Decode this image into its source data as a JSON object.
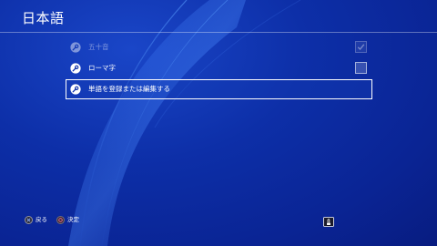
{
  "header": {
    "title": "日本語"
  },
  "menu": {
    "items": [
      {
        "label": "五十音",
        "icon": "wrench-icon",
        "checked": true,
        "enabled": false,
        "selected": false
      },
      {
        "label": "ローマ字",
        "icon": "wrench-icon",
        "checked": false,
        "enabled": true,
        "selected": false
      },
      {
        "label": "単語を登録または編集する",
        "icon": "wrench-icon",
        "selected": true
      }
    ]
  },
  "footer": {
    "back_label": "戻る",
    "confirm_label": "決定"
  },
  "colors": {
    "background": "#0d2fa8",
    "text": "#ffffff"
  }
}
